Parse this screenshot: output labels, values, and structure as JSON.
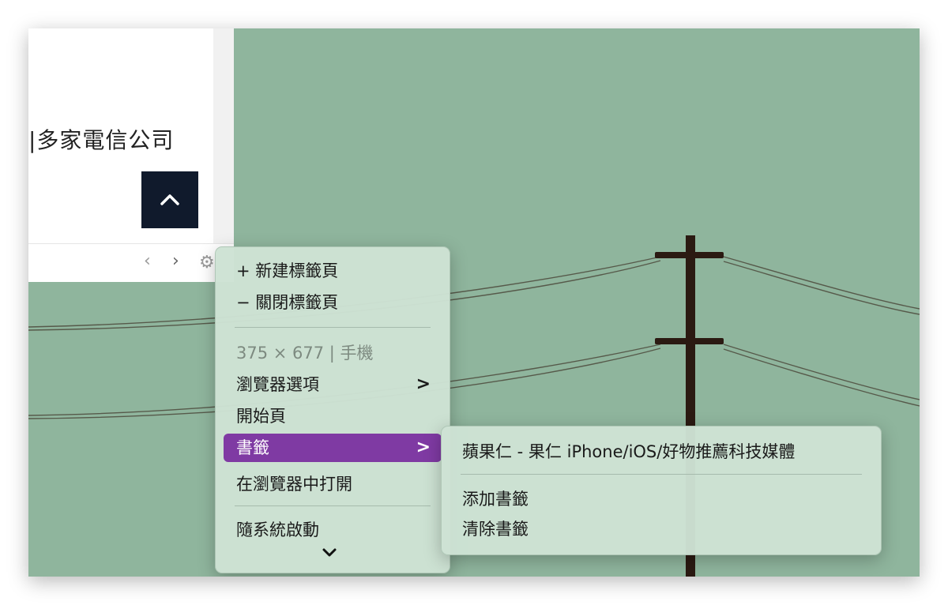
{
  "page": {
    "body_text": "|多家電信公司"
  },
  "toolbar": {
    "back_glyph": "‹",
    "forward_glyph": "›",
    "gear_glyph": "⚙"
  },
  "main_menu": {
    "new_tab": "+ 新建標籤頁",
    "close_tab": "− 關閉標籤頁",
    "device_info": "375 × 677 | 手機",
    "browser_options": "瀏覽器選項",
    "start_page": "開始頁",
    "bookmarks": "書籤",
    "open_in_browser": "在瀏覽器中打開",
    "launch_at_login": "隨系統啟動",
    "submenu_chevron": ">"
  },
  "bookmarks_submenu": {
    "bookmark_item": "蘋果仁 - 果仁 iPhone/iOS/好物推薦科技媒體",
    "add_bookmark": "添加書籤",
    "clear_bookmarks": "清除書籤"
  },
  "colors": {
    "wallpaper": "#8fb59d",
    "menu_background": "#cde2d4",
    "selection": "#7f3aa3",
    "scroll_top_button": "#101a2c",
    "pole": "#2b1a12"
  },
  "icons": {
    "scroll_top": "chevron-up-icon",
    "more": "chevron-down-icon",
    "settings": "gear-icon"
  }
}
